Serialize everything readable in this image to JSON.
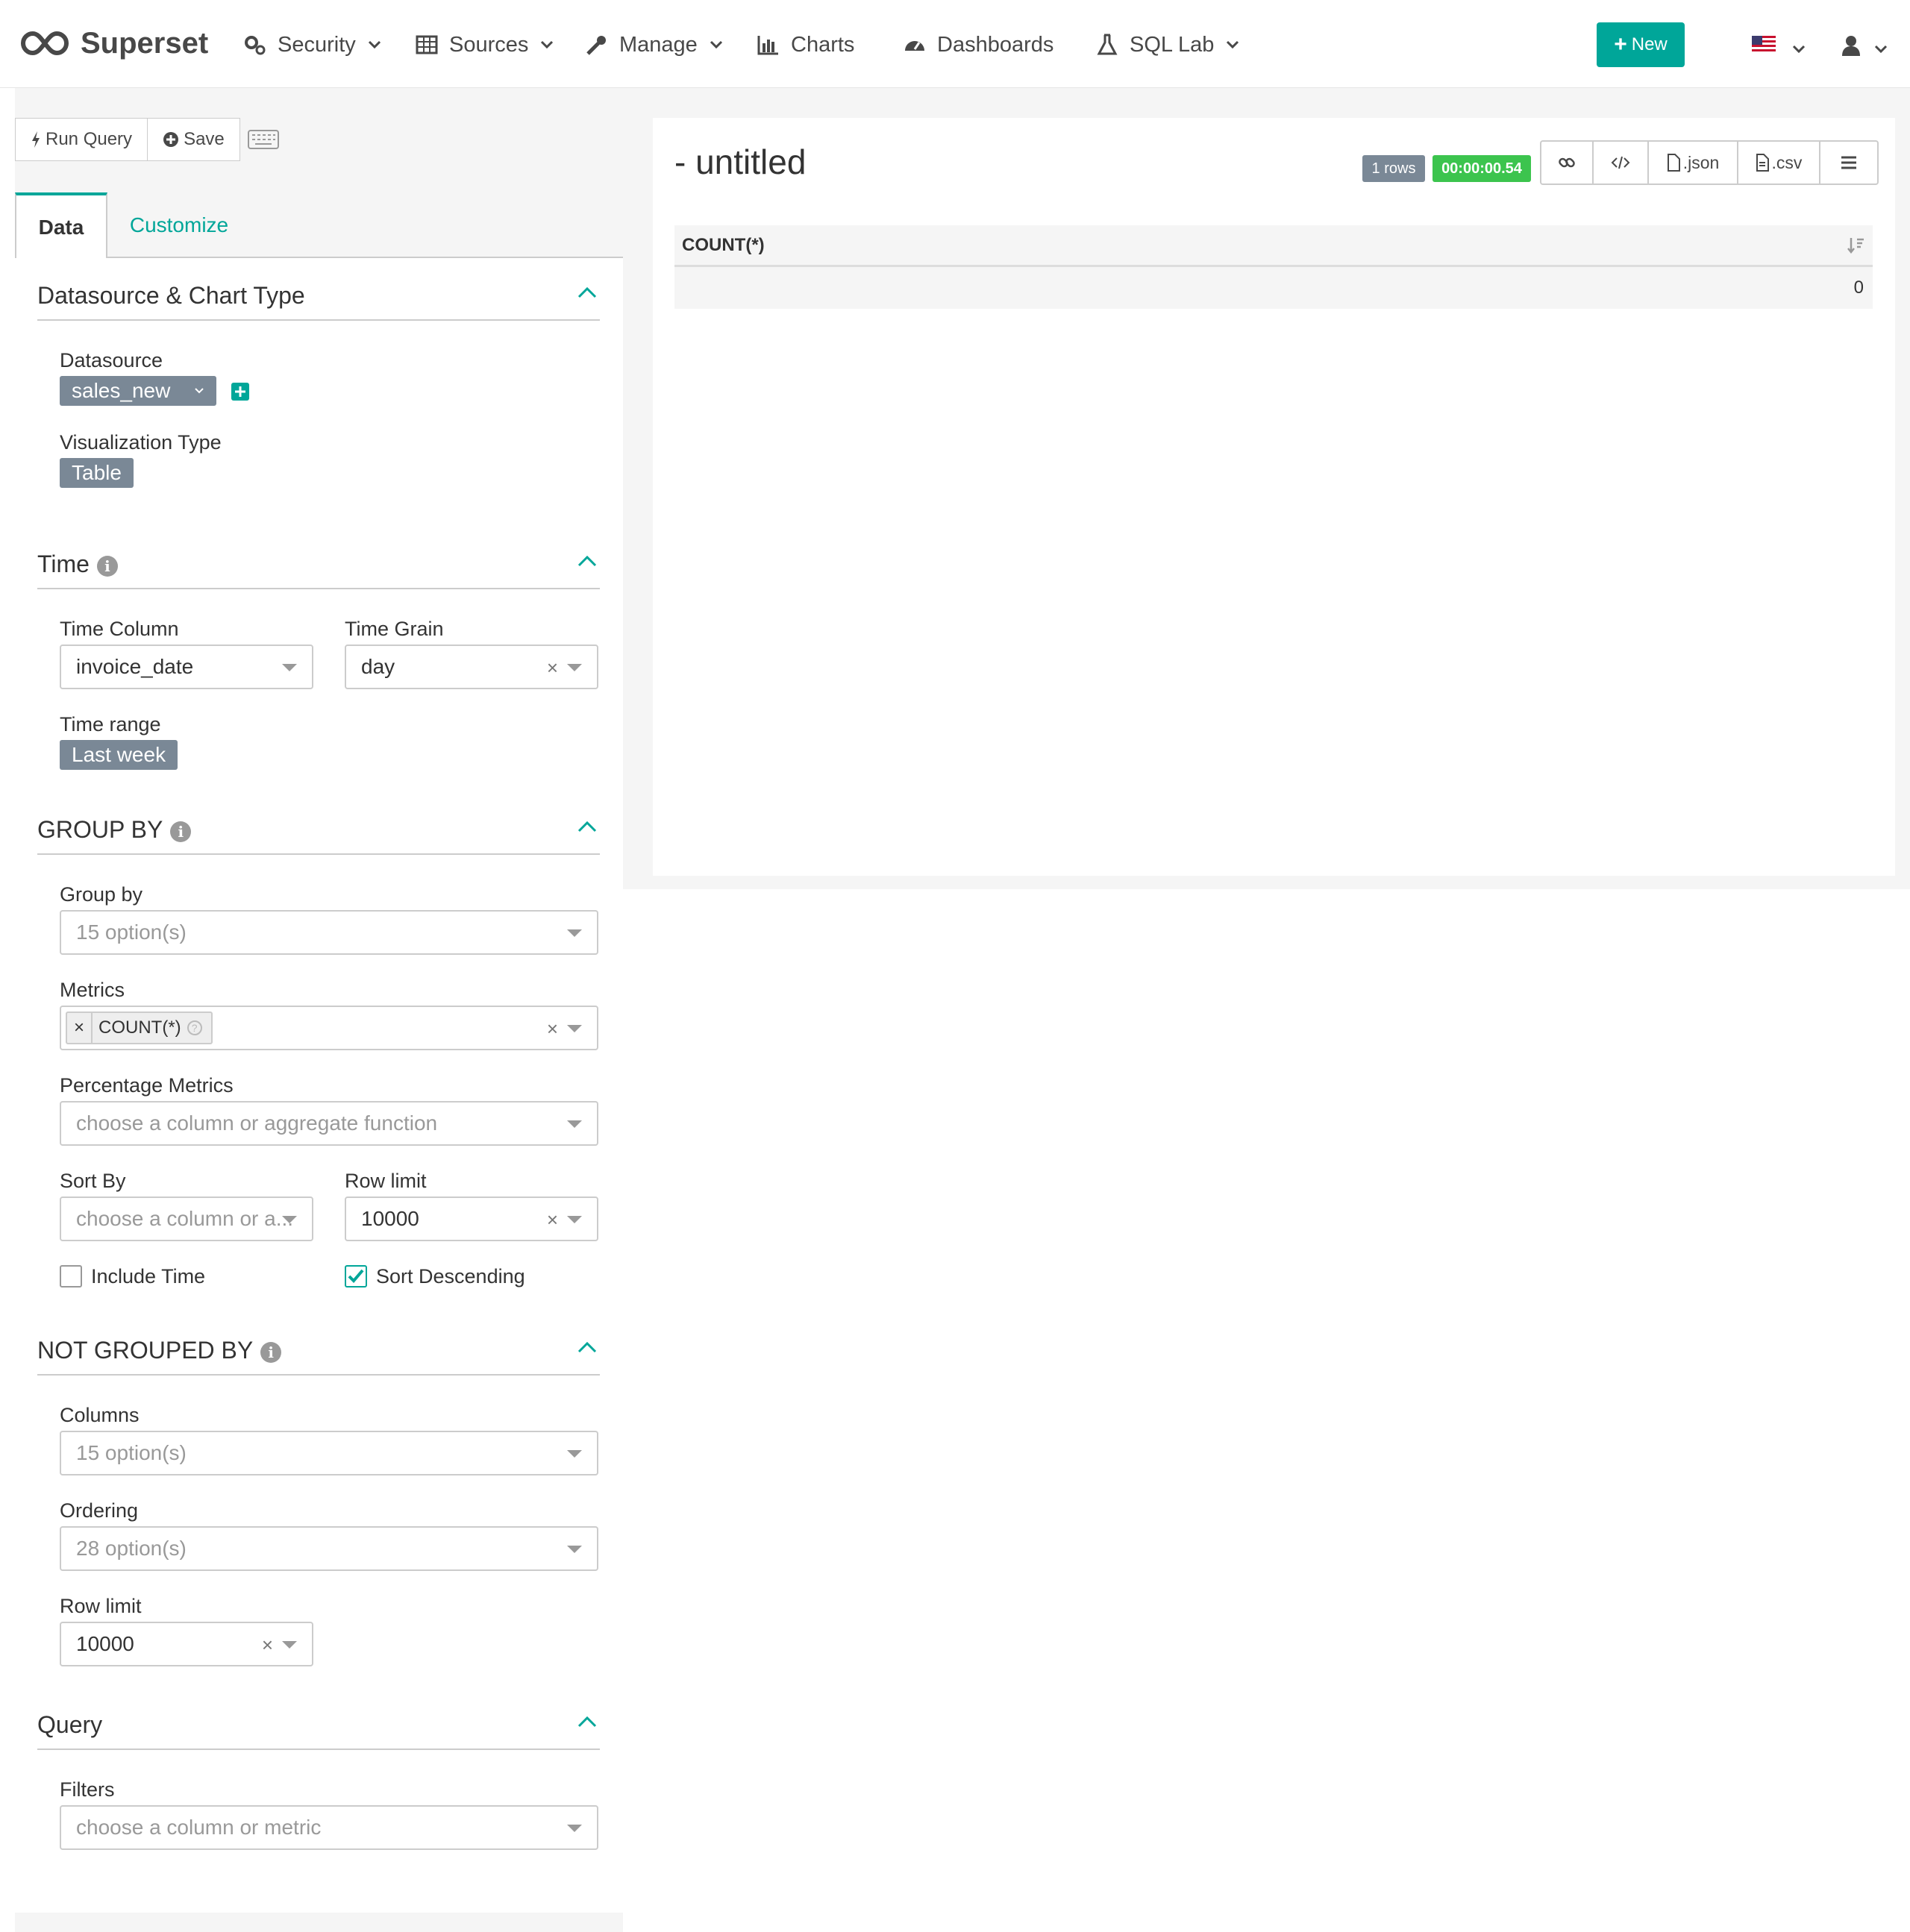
{
  "navbar": {
    "brand": "Superset",
    "items": [
      {
        "label": "Security",
        "icon": "gears-icon"
      },
      {
        "label": "Sources",
        "icon": "table-icon"
      },
      {
        "label": "Manage",
        "icon": "wrench-icon"
      },
      {
        "label": "Charts",
        "icon": "bar-chart-icon"
      },
      {
        "label": "Dashboards",
        "icon": "dashboard-icon"
      },
      {
        "label": "SQL Lab",
        "icon": "flask-icon"
      }
    ],
    "new_label": "New",
    "accent": "#00a699"
  },
  "toolbar": {
    "run_query": "Run Query",
    "save": "Save"
  },
  "tabs": {
    "data": "Data",
    "customize": "Customize"
  },
  "sections": {
    "datasource": {
      "title": "Datasource & Chart Type",
      "datasource_label": "Datasource",
      "datasource_value": "sales_new",
      "viz_label": "Visualization Type",
      "viz_value": "Table"
    },
    "time": {
      "title": "Time",
      "time_column_label": "Time Column",
      "time_column_value": "invoice_date",
      "time_grain_label": "Time Grain",
      "time_grain_value": "day",
      "time_range_label": "Time range",
      "time_range_value": "Last week"
    },
    "group_by": {
      "title": "GROUP BY",
      "group_by_label": "Group by",
      "group_by_placeholder": "15 option(s)",
      "metrics_label": "Metrics",
      "metric_tag": "COUNT(*)",
      "pct_metrics_label": "Percentage Metrics",
      "pct_metrics_placeholder": "choose a column or aggregate function",
      "sort_by_label": "Sort By",
      "sort_by_placeholder": "choose a column or a...",
      "row_limit_label": "Row limit",
      "row_limit_value": "10000",
      "include_time_label": "Include Time",
      "include_time_checked": false,
      "sort_desc_label": "Sort Descending",
      "sort_desc_checked": true
    },
    "not_grouped": {
      "title": "NOT GROUPED BY",
      "columns_label": "Columns",
      "columns_placeholder": "15 option(s)",
      "ordering_label": "Ordering",
      "ordering_placeholder": "28 option(s)",
      "row_limit_label": "Row limit",
      "row_limit_value": "10000"
    },
    "query": {
      "title": "Query",
      "filters_label": "Filters",
      "filters_placeholder": "choose a column or metric"
    }
  },
  "chart": {
    "title": "- untitled",
    "rows_badge": "1 rows",
    "time_badge": "00:00:00.54",
    "json_label": ".json",
    "csv_label": ".csv",
    "table": {
      "columns": [
        "COUNT(*)"
      ],
      "rows": [
        [
          "0"
        ]
      ]
    }
  }
}
